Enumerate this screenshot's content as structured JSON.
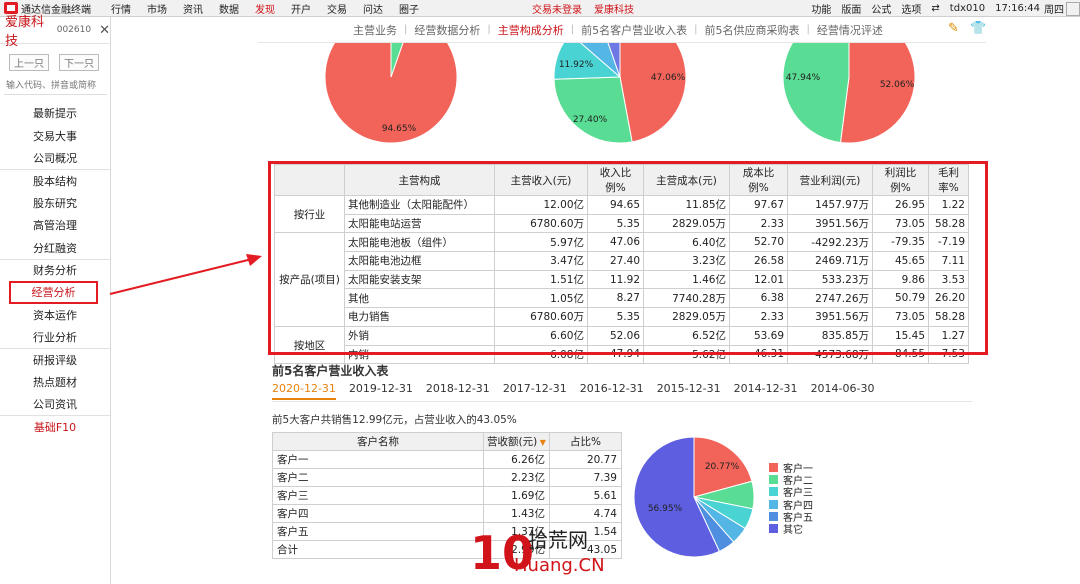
{
  "menubar": {
    "app_title": "通达信金融终端",
    "menu": [
      "行情",
      "市场",
      "资讯",
      "数据",
      "发现",
      "开户",
      "交易",
      "问达",
      "圈子"
    ],
    "active_menu": "发现",
    "status_left": "交易未登录",
    "status_stock": "爱康科技",
    "right_items": [
      "功能",
      "版面",
      "公式",
      "选项"
    ],
    "server": "tdx010",
    "time": "17:16:44",
    "weekday": "周四"
  },
  "stock": {
    "name": "爱康科技",
    "code": "002610",
    "prev_label": "上一只",
    "next_label": "下一只",
    "search_placeholder": "输入代码、拼音或简称"
  },
  "sidenav": {
    "items": [
      "最新提示",
      "交易大事",
      "公司概况",
      "股本结构",
      "股东研究",
      "高管治理",
      "分红融资",
      "财务分析",
      "经营分析",
      "资本运作",
      "行业分析",
      "研报评级",
      "热点题材",
      "公司资讯",
      "基础F10"
    ],
    "active": "经营分析"
  },
  "tabs": {
    "items": [
      "主营业务",
      "经营数据分析",
      "主营构成分析",
      "前5名客户营业收入表",
      "前5名供应商采购表",
      "经营情况评述"
    ],
    "active": "主营构成分析"
  },
  "pie_top": {
    "pie1": {
      "labels": [
        "94.65%"
      ],
      "values": [
        94.65,
        5.35
      ],
      "colors": [
        "#f2645a",
        "#59dc93"
      ]
    },
    "pie2": {
      "labels": [
        "47.06%",
        "27.40%",
        "11.92%"
      ],
      "values": [
        47.06,
        27.4,
        11.92,
        8.27,
        5.35
      ],
      "colors": [
        "#f2645a",
        "#59dc93",
        "#4ad3d3",
        "#53b6e4",
        "#6d78e5"
      ]
    },
    "pie3": {
      "labels": [
        "52.06%",
        "47.94%"
      ],
      "values": [
        52.06,
        47.94
      ],
      "colors": [
        "#f2645a",
        "#59dc93"
      ]
    }
  },
  "composition": {
    "headers": [
      "主营构成",
      "主营收入(元)",
      "收入比例%",
      "主营成本(元)",
      "成本比例%",
      "营业利润(元)",
      "利润比例%",
      "毛利率%"
    ],
    "groups": [
      {
        "name": "按行业",
        "rows": [
          [
            "其他制造业（太阳能配件）",
            "12.00亿",
            "94.65",
            "11.85亿",
            "97.67",
            "1457.97万",
            "26.95",
            "1.22"
          ],
          [
            "太阳能电站运营",
            "6780.60万",
            "5.35",
            "2829.05万",
            "2.33",
            "3951.56万",
            "73.05",
            "58.28"
          ]
        ]
      },
      {
        "name": "按产品(项目)",
        "rows": [
          [
            "太阳能电池板（组件）",
            "5.97亿",
            "47.06",
            "6.40亿",
            "52.70",
            "-4292.23万",
            "-79.35",
            "-7.19"
          ],
          [
            "太阳能电池边框",
            "3.47亿",
            "27.40",
            "3.23亿",
            "26.58",
            "2469.71万",
            "45.65",
            "7.11"
          ],
          [
            "太阳能安装支架",
            "1.51亿",
            "11.92",
            "1.46亿",
            "12.01",
            "533.23万",
            "9.86",
            "3.53"
          ],
          [
            "其他",
            "1.05亿",
            "8.27",
            "7740.28万",
            "6.38",
            "2747.26万",
            "50.79",
            "26.20"
          ],
          [
            "电力销售",
            "6780.60万",
            "5.35",
            "2829.05万",
            "2.33",
            "3951.56万",
            "73.05",
            "58.28"
          ]
        ]
      },
      {
        "name": "按地区",
        "rows": [
          [
            "外销",
            "6.60亿",
            "52.06",
            "6.52亿",
            "53.69",
            "835.85万",
            "15.45",
            "1.27"
          ],
          [
            "内销",
            "6.08亿",
            "47.94",
            "5.62亿",
            "46.31",
            "4573.68万",
            "84.55",
            "7.53"
          ]
        ]
      }
    ]
  },
  "customers": {
    "title": "前5名客户营业收入表",
    "dates": [
      "2020-12-31",
      "2019-12-31",
      "2018-12-31",
      "2017-12-31",
      "2016-12-31",
      "2015-12-31",
      "2014-12-31",
      "2014-06-30"
    ],
    "active_date": "2020-12-31",
    "summary": "前5大客户共销售12.99亿元，占营业收入的43.05%",
    "headers": [
      "客户名称",
      "营收额(元)",
      "占比%"
    ],
    "rows": [
      [
        "客户一",
        "6.26亿",
        "20.77"
      ],
      [
        "客户二",
        "2.23亿",
        "7.39"
      ],
      [
        "客户三",
        "1.69亿",
        "5.61"
      ],
      [
        "客户四",
        "1.43亿",
        "4.74"
      ],
      [
        "客户五",
        "1.37亿",
        "1.54"
      ],
      [
        "合计",
        "12.99亿",
        "43.05"
      ]
    ],
    "pie": {
      "labels": [
        "20.77%",
        "56.95%"
      ],
      "values": [
        20.77,
        7.39,
        5.61,
        4.74,
        4.54,
        56.95
      ],
      "colors": [
        "#f2645a",
        "#59dc93",
        "#4ad3d3",
        "#53b6e4",
        "#4f8fe0",
        "#5d5ee0"
      ]
    },
    "legend": [
      "客户一",
      "客户二",
      "客户三",
      "客户四",
      "客户五",
      "其它"
    ]
  },
  "watermark": {
    "top": "拾荒网",
    "bottom": "Huang.CN",
    "mark": "10"
  }
}
